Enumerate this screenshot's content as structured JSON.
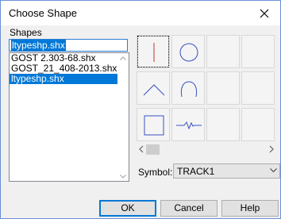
{
  "window": {
    "title": "Choose Shape"
  },
  "shapes": {
    "label": "Shapes",
    "name_field_value": "ltypeshp.shx",
    "list_items": [
      "GOST 2.303-68.shx",
      "GOST_21_408-2013.shx",
      "ltypeshp.shx"
    ],
    "selected_index": 2
  },
  "preview_grid": {
    "cells": [
      {
        "icon": "vertical-line",
        "selected": true
      },
      {
        "icon": "circle"
      },
      {
        "icon": "empty"
      },
      {
        "icon": "empty"
      },
      {
        "icon": "caret-chevron"
      },
      {
        "icon": "arch-bell"
      },
      {
        "icon": "empty"
      },
      {
        "icon": "empty"
      },
      {
        "icon": "square"
      },
      {
        "icon": "zigzag-track"
      },
      {
        "icon": "empty"
      },
      {
        "icon": "empty"
      }
    ]
  },
  "symbol": {
    "label": "Symbol:",
    "value": "TRACK1"
  },
  "buttons": {
    "ok": "OK",
    "cancel": "Cancel",
    "help": "Help"
  },
  "colors": {
    "accent": "#0078d7",
    "shape_line": "#3a4fc4",
    "selected_shape_line": "#c0392b"
  }
}
